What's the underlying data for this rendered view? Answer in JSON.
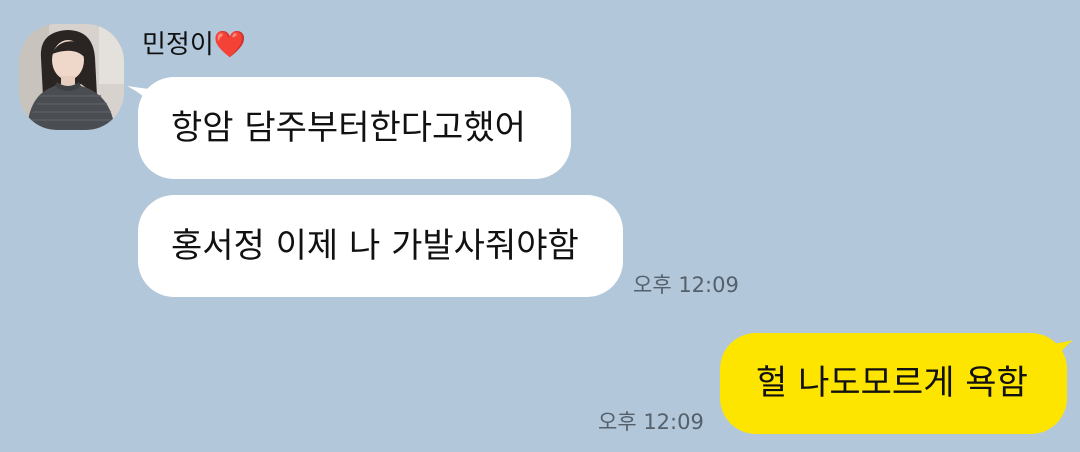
{
  "chat": {
    "sender_name": "민정이❤️",
    "messages_in": [
      {
        "text": "항암 담주부터한다고했어"
      },
      {
        "text": "홍서정 이제 나 가발사줘야함"
      }
    ],
    "time_in": "오후 12:09",
    "message_out": {
      "text": "헐 나도모르게 욕함"
    },
    "time_out": "오후 12:09"
  },
  "colors": {
    "background": "#b2c7da",
    "incoming_bubble": "#ffffff",
    "outgoing_bubble": "#fee500",
    "timestamp": "#54606b"
  },
  "icons": {
    "avatar": "profile-photo"
  }
}
